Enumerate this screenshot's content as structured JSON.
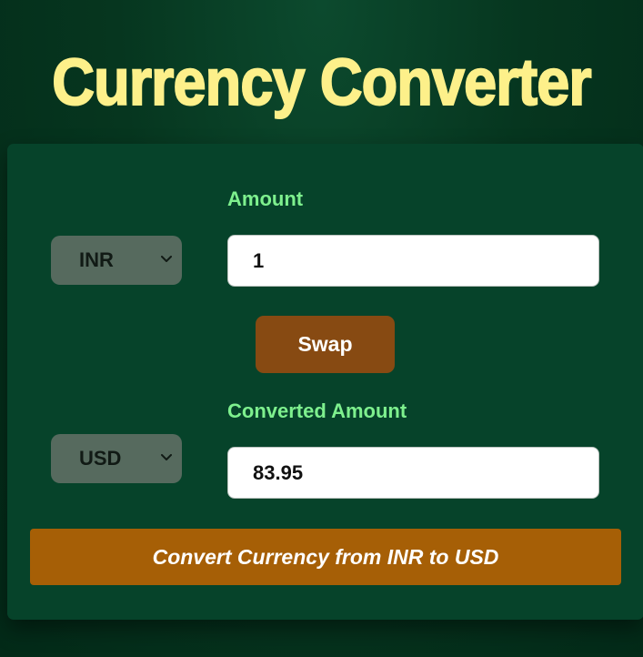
{
  "app": {
    "title": "Currency Converter"
  },
  "from": {
    "label": "Amount",
    "currency": "INR",
    "value": "1"
  },
  "to": {
    "label": "Converted Amount",
    "currency": "USD",
    "value": "83.95"
  },
  "buttons": {
    "swap_label": "Swap",
    "convert_label": "Convert Currency from INR to USD"
  },
  "icons": {
    "from_select": "chevron-down-icon",
    "to_select": "chevron-down-icon"
  },
  "colors": {
    "title": "#fdf08a",
    "label": "#7ef08e",
    "card": "#06432a",
    "swap_button": "#874a12",
    "convert_button": "#a65f06",
    "select_bg": "#566a5e"
  }
}
